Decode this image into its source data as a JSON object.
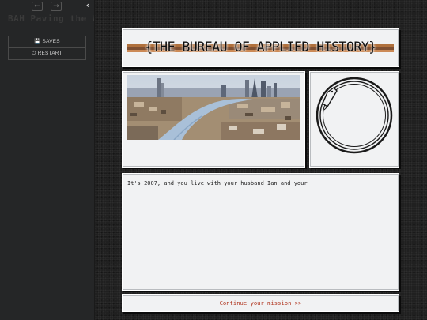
{
  "sidebar": {
    "nav_back_icon": "arrow-left-icon",
    "nav_forward_icon": "arrow-right-icon",
    "collapse_icon": "chevron-left-icon",
    "story_title": "BAH Paving the W",
    "menu": [
      {
        "label": "SAVES",
        "icon": "floppy-disk-icon"
      },
      {
        "label": "RESTART",
        "icon": "power-icon"
      }
    ]
  },
  "story": {
    "banner_title": "{THE BUREAU OF APPLIED HISTORY}",
    "photo_subject": "london-skyline-image",
    "logo_subject": "ouroboros-icon",
    "passage_text": "It's 2007, and you live with your husband Ian and your",
    "continue_link": "Continue your mission >>"
  },
  "colors": {
    "panel_bg": "#f1f2f3",
    "sidebar_bg": "#252627",
    "link": "#b0341e",
    "banner_stripe": "#a55a1d"
  }
}
